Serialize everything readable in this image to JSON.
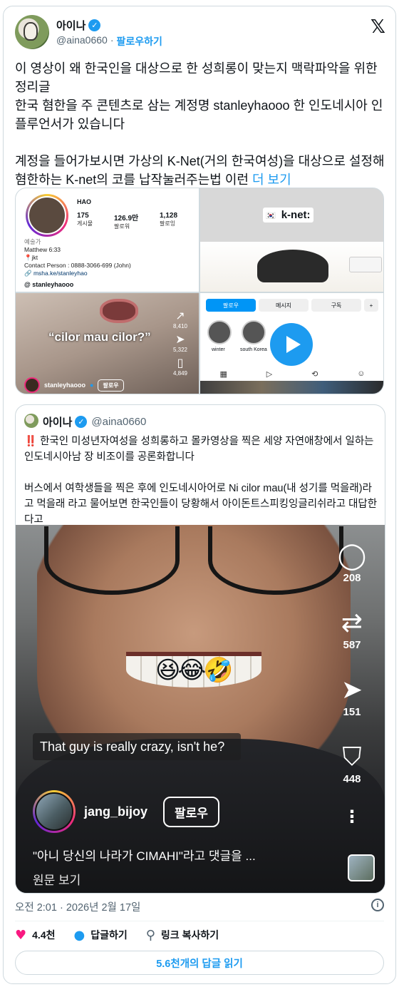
{
  "author": {
    "name": "아이나",
    "handle": "@aina0660",
    "separator": "·",
    "follow_label": "팔로우하기"
  },
  "post": {
    "text": "이 영상이 왜 한국인을 대상으로 한 성희롱이 맞는지 맥락파악을 위한 정리글\n한국 혐한을 주 콘텐츠로 삼는 계정명 stanleyhaooo 한 인도네시아 인플루언서가 있습니다\n\n계정을 들어가보시면 가상의 K-Net(거의 한국여성)을 대상으로 설정해 혐한하는 K-net의 코를 납작눌러주는법 이런 ",
    "more_label": "더 보기"
  },
  "media": {
    "profile": {
      "name": "HAO",
      "posts_count": "175",
      "posts_label": "게시물",
      "followers_count": "126.9만",
      "followers_label": "팔로워",
      "following_count": "1,128",
      "following_label": "팔로잉",
      "category": "예술가",
      "bio_line1": "Matthew 6:33",
      "bio_line2": "📍jkt",
      "bio_line3": "Contact Person : 0888-3066-699 (John)",
      "link": "🔗 msha.ke/stanleyhao",
      "threads": "@ stanleyhaooo"
    },
    "knet": {
      "label": "k-net:"
    },
    "clip": {
      "caption": "“cilor mau cilor?”",
      "likes": "8,410",
      "shares": "5,322",
      "saves": "4,849",
      "username": "stanleyhaooo",
      "follow_label": "팔로우"
    },
    "profile2": {
      "tab_follow": "팔로우",
      "tab_message": "메시지",
      "tab_subscribe": "구독",
      "highlight1": "winter",
      "highlight2": "south Korea"
    }
  },
  "quote": {
    "name": "아이나",
    "handle": "@aina0660",
    "warn": "‼️",
    "text": " 한국인 미성년자여성을 성희롱하고 몰카영상을 찍은 세양 자연애창에서 일하는 인도네시아남 장 비조이를 공론화합니다\n\n버스에서 여학생들을 찍은 후에 인도네시아어로 Ni cilor mau(내 성기를 먹을래)라고 먹을래 라고 물어보면 한국인들이 당황해서 아이돈트스피킹잉글리쉬라고 대답한다고",
    "video": {
      "emoji": "😆😂🤣",
      "comments": "208",
      "reposts": "587",
      "shares": "151",
      "saves": "448",
      "caption": "That guy is really crazy, isn't he?",
      "username": "jang_bijoy",
      "follow_label": "팔로우",
      "description": "\"아니 당신의 나라가 CIMAHI\"라고 댓글을 ...",
      "original_label": "원문 보기"
    }
  },
  "footer": {
    "timestamp": "오전 2:01 · 2026년 2월 17일",
    "likes": "4.4천",
    "reply_label": "답글하기",
    "copy_link_label": "링크 복사하기",
    "read_replies": "5.6천개의 답글 읽기"
  },
  "icons": {
    "verified": "verified-badge-icon",
    "x_logo": "x-logo-icon",
    "heart": "heart-icon",
    "reply": "reply-bubble-icon",
    "link": "link-icon",
    "info": "info-icon"
  },
  "colors": {
    "accent": "#1d9bf0",
    "like": "#f91880",
    "text": "#0f1419",
    "muted": "#536471"
  }
}
